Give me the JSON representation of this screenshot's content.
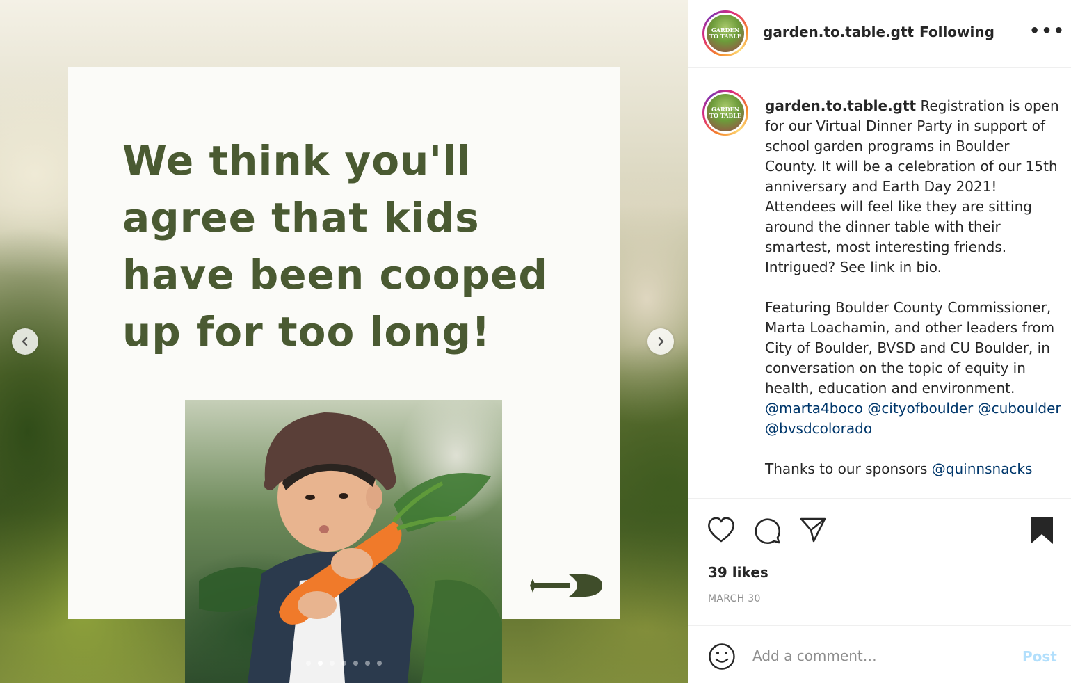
{
  "post": {
    "headline": "We think you'll agree that kids have been cooped up for too long!",
    "carousel": {
      "slide_count": 7,
      "active_index": 1
    }
  },
  "header": {
    "username": "garden.to.table.gtt",
    "separator": "•",
    "follow_status": "Following",
    "more_label": "•••"
  },
  "avatar": {
    "logo_text": "GARDEN TO TABLE"
  },
  "caption": {
    "username": "garden.to.table.gtt",
    "paragraph1": " Registration is open for our Virtual Dinner Party in support of school garden programs in Boulder County. It will be a celebration of our 15th anniversary and Earth Day 2021! Attendees will feel like they are sitting around the dinner table with their smartest, most interesting friends. Intrigued? See link in bio.",
    "paragraph2_text": "Featuring Boulder County Commissioner, Marta Loachamin, and other leaders from City of Boulder, BVSD and CU Boulder, in conversation on the topic of equity in health, education and environment. ",
    "mentions": [
      "@marta4boco",
      "@cityofboulder",
      "@cuboulder",
      "@bvsdcolorado"
    ],
    "paragraph3_text": "Thanks to our sponsors ",
    "paragraph3_mention": "@quinnsnacks"
  },
  "engagement": {
    "likes": "39 likes",
    "date": "MARCH 30"
  },
  "comment": {
    "placeholder": "Add a comment…",
    "post_label": "Post"
  },
  "colors": {
    "headline": "#4a5a32",
    "mention": "#00376b",
    "post_disabled": "#b2dffc",
    "meta": "#8e8e8e"
  },
  "icons": [
    "heart-icon",
    "comment-icon",
    "share-icon",
    "bookmark-icon",
    "emoji-icon",
    "chevron-left-icon",
    "chevron-right-icon",
    "shovel-icon"
  ]
}
